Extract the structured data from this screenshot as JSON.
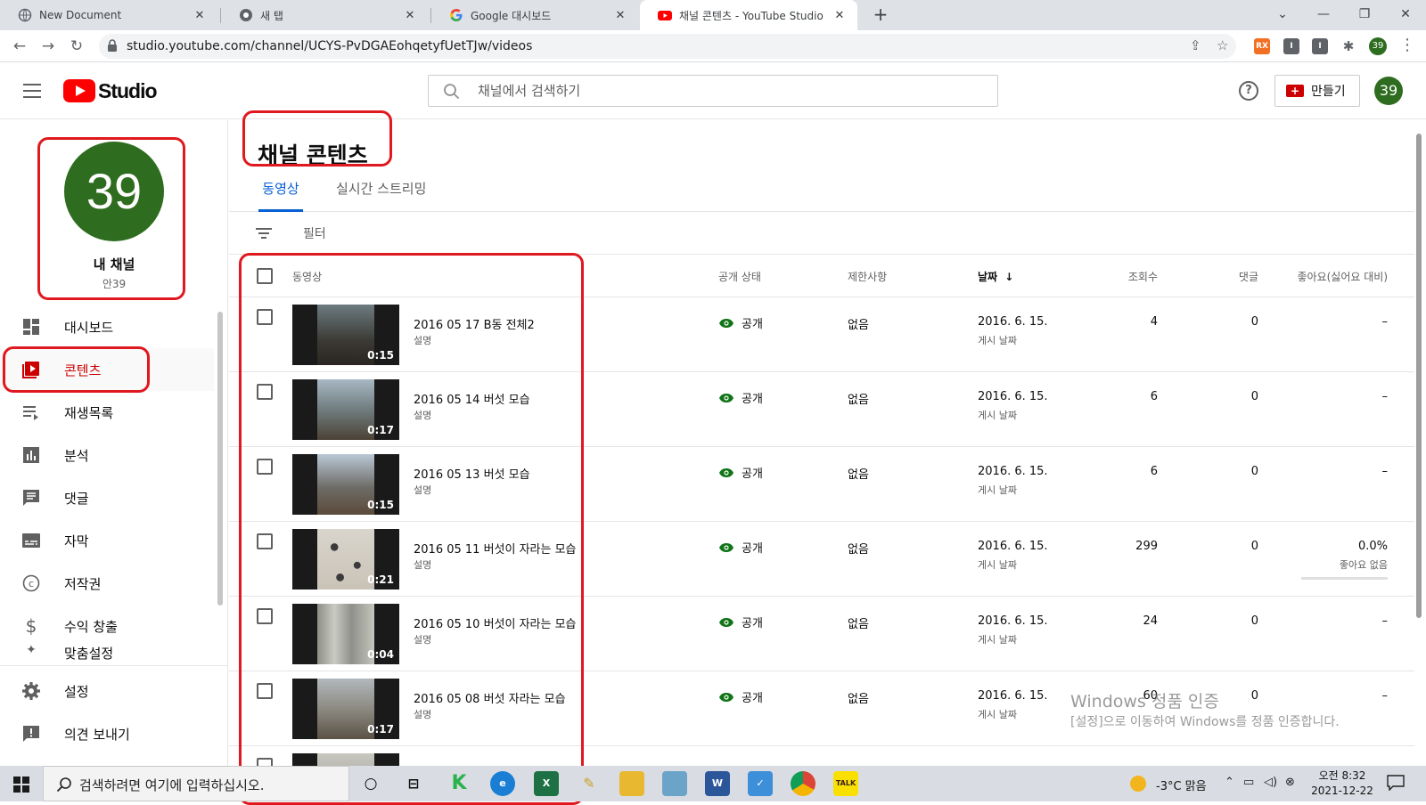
{
  "browser": {
    "tabs": [
      {
        "label": "New Document",
        "close": "✕"
      },
      {
        "label": "새 탭",
        "close": "✕"
      },
      {
        "label": "Google 대시보드",
        "close": "✕"
      },
      {
        "label": "채널 콘텐츠 - YouTube Studio",
        "close": "✕"
      }
    ],
    "url": "studio.youtube.com/channel/UCYS-PvDGAEohqetyfUetTJw/videos",
    "profile_number": "39"
  },
  "header": {
    "logo_text": "Studio",
    "search_placeholder": "채널에서 검색하기",
    "create_label": "만들기",
    "avatar_number": "39"
  },
  "sidebar": {
    "avatar_number": "39",
    "channel_name": "내 채널",
    "channel_handle": "안39",
    "items": [
      {
        "label": "대시보드",
        "icon": "dashboard-icon"
      },
      {
        "label": "콘텐츠",
        "icon": "content-icon"
      },
      {
        "label": "재생목록",
        "icon": "playlist-icon"
      },
      {
        "label": "분석",
        "icon": "analytics-icon"
      },
      {
        "label": "댓글",
        "icon": "comments-icon"
      },
      {
        "label": "자막",
        "icon": "subtitles-icon"
      },
      {
        "label": "저작권",
        "icon": "copyright-icon"
      },
      {
        "label": "수익 창출",
        "icon": "dollar-icon"
      },
      {
        "label": "맞춤설정",
        "icon": "customize-icon"
      }
    ],
    "bottom": [
      {
        "label": "설정",
        "icon": "gear-icon"
      },
      {
        "label": "의견 보내기",
        "icon": "feedback-icon"
      }
    ]
  },
  "main": {
    "title": "채널 콘텐츠",
    "tabs": [
      "동영상",
      "실시간 스트리밍"
    ],
    "filter_label": "필터",
    "columns": {
      "video": "동영상",
      "visibility": "공개 상태",
      "restrictions": "제한사항",
      "date": "날짜",
      "views": "조회수",
      "comments": "댓글",
      "likes": "좋아요(싫어요 대비)"
    },
    "rows": [
      {
        "title": "2016 05 17 B동 전체2",
        "desc": "설명",
        "duration": "0:15",
        "visibility": "공개",
        "restrictions": "없음",
        "date": "2016. 6. 15.",
        "date_sub": "게시 날짜",
        "views": "4",
        "comments": "0",
        "likes": "–",
        "likes_sub": ""
      },
      {
        "title": "2016 05 14 버섯 모습",
        "desc": "설명",
        "duration": "0:17",
        "visibility": "공개",
        "restrictions": "없음",
        "date": "2016. 6. 15.",
        "date_sub": "게시 날짜",
        "views": "6",
        "comments": "0",
        "likes": "–",
        "likes_sub": ""
      },
      {
        "title": "2016 05 13 버섯 모습",
        "desc": "설명",
        "duration": "0:15",
        "visibility": "공개",
        "restrictions": "없음",
        "date": "2016. 6. 15.",
        "date_sub": "게시 날짜",
        "views": "6",
        "comments": "0",
        "likes": "–",
        "likes_sub": ""
      },
      {
        "title": "2016 05 11 버섯이 자라는 모습",
        "desc": "설명",
        "duration": "0:21",
        "visibility": "공개",
        "restrictions": "없음",
        "date": "2016. 6. 15.",
        "date_sub": "게시 날짜",
        "views": "299",
        "comments": "0",
        "likes": "0.0%",
        "likes_sub": "좋아요 없음"
      },
      {
        "title": "2016 05 10 버섯이 자라는 모습",
        "desc": "설명",
        "duration": "0:04",
        "visibility": "공개",
        "restrictions": "없음",
        "date": "2016. 6. 15.",
        "date_sub": "게시 날짜",
        "views": "24",
        "comments": "0",
        "likes": "–",
        "likes_sub": ""
      },
      {
        "title": "2016 05 08 버섯 자라는 모습",
        "desc": "설명",
        "duration": "0:17",
        "visibility": "공개",
        "restrictions": "없음",
        "date": "2016. 6. 15.",
        "date_sub": "게시 날짜",
        "views": "60",
        "comments": "0",
        "likes": "–",
        "likes_sub": ""
      }
    ]
  },
  "watermark": {
    "line1": "Windows 정품 인증",
    "line2": "[설정]으로 이동하여 Windows를 정품 인증합니다."
  },
  "taskbar": {
    "search_text": "검색하려면 여기에 입력하십시오.",
    "weather": "-3°C  맑음",
    "time": "오전 8:32",
    "date": "2021-12-22"
  },
  "colors": {
    "accent_blue": "#065fd4",
    "youtube_red": "#ff0000",
    "annotation_red": "#e0181f",
    "avatar_green": "#2e6d1f",
    "public_green": "#107516"
  }
}
